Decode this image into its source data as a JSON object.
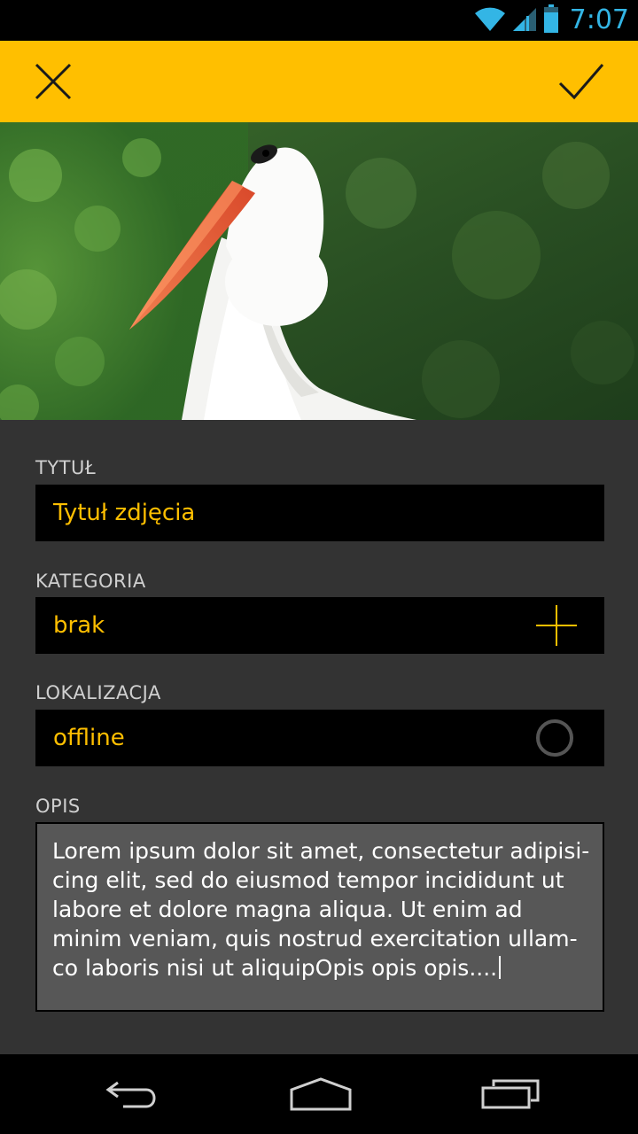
{
  "status_bar": {
    "time": "7:07",
    "icons": [
      "wifi-icon",
      "signal-icon",
      "battery-icon"
    ],
    "accent_color": "#33b5e5"
  },
  "action_bar": {
    "background_color": "#ffbf00",
    "left_icon": "close-icon",
    "right_icon": "checkmark-icon"
  },
  "photo": {
    "subject": "stork-photo"
  },
  "form": {
    "title": {
      "label": "TYTUŁ",
      "value": "Tytuł zdjęcia"
    },
    "category": {
      "label": "KATEGORIA",
      "value": "brak",
      "icon": "plus-icon"
    },
    "location": {
      "label": "LOKALIZACJA",
      "value": "offline",
      "icon": "circle-icon"
    },
    "description": {
      "label": "OPIS",
      "value": "Lorem ipsum dolor sit amet, consectetur adipisi-\ncing elit, sed do eiusmod tempor incididunt ut\nlabore et dolore magna aliqua. Ut enim ad\nminim veniam, quis nostrud exercitation ullam-\nco laboris nisi ut aliquipOpis opis opis...."
    },
    "value_color": "#ffbf00"
  },
  "nav_bar": {
    "icons": [
      "back-icon",
      "home-icon",
      "recent-apps-icon"
    ]
  }
}
